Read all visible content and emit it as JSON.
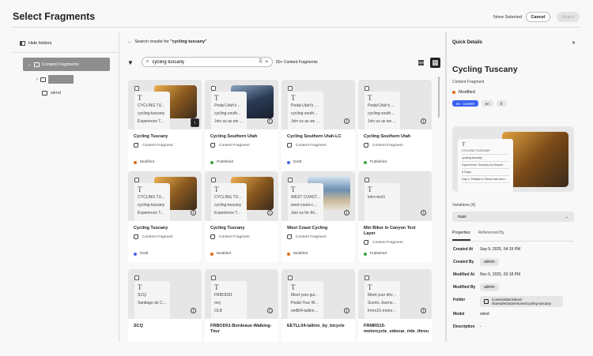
{
  "header": {
    "title": "Select Fragments",
    "selection_status": "None Selected",
    "cancel": "Cancel",
    "select": "Select"
  },
  "sidebar": {
    "hide_folders": "Hide folders",
    "tree": [
      {
        "label": "Content Fragments"
      },
      {
        "label": ""
      },
      {
        "label": "wknd"
      }
    ]
  },
  "main": {
    "back_text": "Search results for ",
    "query_quoted": "\"cycling tuscany\"",
    "search_value": "cycling tuscany",
    "result_count": "50+ Content Fragments",
    "cards": [
      {
        "title": "Cycling Tuscany",
        "type": "Content Fragment",
        "status": "Modified",
        "fields": [
          "CYCLING TU...",
          "cycling-tuscany",
          "Experience T..."
        ],
        "img": "gold"
      },
      {
        "title": "Cycling Southern Utah",
        "type": "Content Fragment",
        "status": "Published",
        "fields": [
          "Pedal Utah's ...",
          "cycling-south...",
          "Join us as we ..."
        ],
        "img": "city"
      },
      {
        "title": "Cycling Southern Utah-LC",
        "type": "Content Fragment",
        "status": "Draft",
        "fields": [
          "Pedal Utah's ...",
          "cycling-south...",
          "Join us as we ..."
        ]
      },
      {
        "title": "Cycling Southern Utah",
        "type": "Content Fragment",
        "status": "Published",
        "fields": [
          "Pedal Utah's ...",
          "cycling-south...",
          "Join us as we ..."
        ]
      },
      {
        "title": "Cycling Tuscany",
        "type": "Content Fragment",
        "status": "Draft",
        "fields": [
          "CYCLING TU...",
          "cycling-tuscany",
          "Experience T..."
        ],
        "img": "gold"
      },
      {
        "title": "Cycling Tuscany",
        "type": "Content Fragment",
        "status": "Modified",
        "fields": [
          "CYCLING TU...",
          "cycling-tuscany",
          "Experience T..."
        ],
        "img": "gold"
      },
      {
        "title": "West Coast Cycling",
        "type": "Content Fragment",
        "status": "Modified",
        "fields": [
          "WEST COAST...",
          "west-coast-c...",
          "Join us for thi..."
        ],
        "img": "coast"
      },
      {
        "title": "Mtn Biker in Canyon Text Layer",
        "type": "Content Fragment",
        "status": "Published",
        "fields": [
          "intro-text1"
        ]
      },
      {
        "title": "SCQ",
        "type": "",
        "status": "",
        "fields": [
          "SCQ",
          "Santiago de Compost..."
        ]
      },
      {
        "title": "FRBOD01-Bordeaux-Walking-Tour",
        "type": "",
        "status": "",
        "fields": [
          "FRBOD01",
          "mvj",
          "OLB"
        ]
      },
      {
        "title": "EETLL04-tallinn_by_bicycle",
        "type": "",
        "status": "",
        "fields": [
          "Meet your guide for a...",
          "Pedal Your Way Thro...",
          "eetll04-tallinn_by_bi..."
        ]
      },
      {
        "title": "FRMRS15-motorcycle_sidecar_ride_throu",
        "type": "",
        "status": "",
        "fields": [
          "Meet your driver, the...",
          "Scenic Journey from ...",
          "frmrs15-motorcycle_s..."
        ]
      }
    ]
  },
  "status_colors": {
    "Modified": "#e0680f",
    "Published": "#3fa33f",
    "Draft": "#4466ee"
  },
  "details": {
    "header": "Quick Details",
    "title": "Cycling Tuscany",
    "type": "Content Fragment",
    "status": "Modified",
    "locales": [
      "es - current",
      "en",
      "fr"
    ],
    "preview_fields": [
      "CYCLING TUSCANY",
      "cycling-tuscany",
      "Experience Tuscany by Bicycle",
      "5 Days",
      "Day 1: Radda to Siena was amazi..."
    ],
    "variations_label": "Variations  (4)",
    "variation": "main",
    "tabs": [
      "Properties",
      "Referenced By"
    ],
    "props": {
      "created_at_k": "Created At",
      "created_at": "Sep 9, 2025, 04:19 PM",
      "created_by_k": "Created By",
      "created_by": "admin",
      "modified_at_k": "Modified At",
      "modified_at": "Nov 5, 2025, 03:18 PM",
      "modified_by_k": "Modified By",
      "modified_by": "admin",
      "folder_k": "Folder",
      "folder": "/content/dam/wknd-shared/es/adventures/cycling-tuscany",
      "model_k": "Model",
      "model": "wknd",
      "description_k": "Description",
      "description": "-"
    }
  }
}
